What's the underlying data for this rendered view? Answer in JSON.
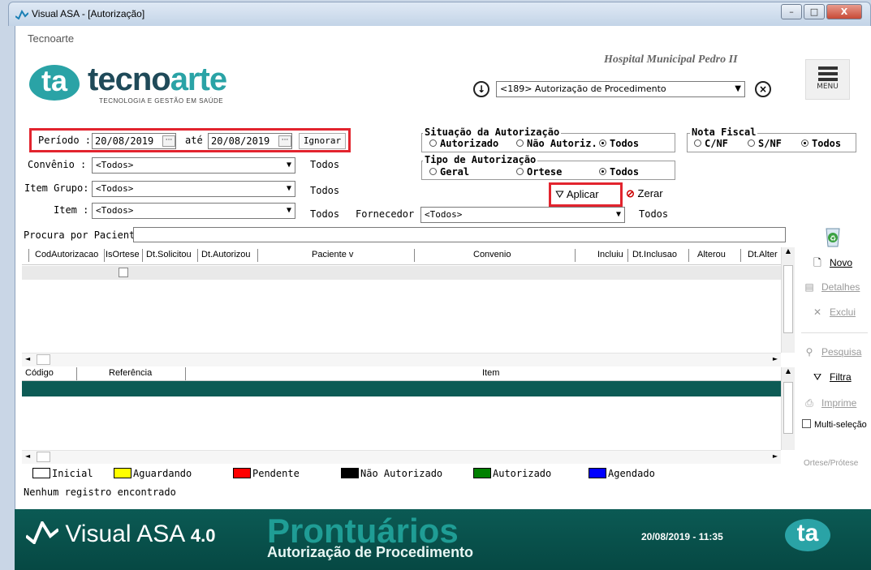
{
  "window": {
    "title": "Visual ASA - [Autorização]",
    "min": "–",
    "max": "□",
    "close": "X"
  },
  "header": {
    "company_label": "Tecnoarte",
    "hospital": "Hospital Municipal Pedro II",
    "logo_mark": "ta",
    "logo_word_a": "tecno",
    "logo_word_b": "arte",
    "logo_sub": "TECNOLOGIA E GESTÃO EM SAÚDE",
    "module_select": "<189> Autorização de Procedimento",
    "menu_label": "MENU"
  },
  "filters": {
    "periodo_label": "Período :",
    "periodo_de": "20/08/2019",
    "ate_label": "até",
    "periodo_ate": "20/08/2019",
    "dots": "···",
    "ignorar": "Ignorar",
    "convenio_label": "Convênio :",
    "convenio_value": "<Todos>",
    "convenio_todos": "Todos",
    "item_grupo_label": "Item Grupo:",
    "item_grupo_value": "<Todos>",
    "item_grupo_todos": "Todos",
    "item_label": "Item :",
    "item_value": "<Todos>",
    "item_todos": "Todos",
    "fornecedor_label": "Fornecedor :",
    "fornecedor_value": "<Todos>",
    "fornecedor_todos": "Todos",
    "paciente_label": "Procura por Paciente:",
    "paciente_value": "",
    "aplicar": "Aplicar",
    "zerar": "Zerar"
  },
  "situacao": {
    "title": "Situação da Autorização",
    "options": [
      "Autorizado",
      "Não Autoriz.",
      "Todos"
    ],
    "selected": 2
  },
  "tipo": {
    "title": "Tipo de Autorização",
    "options": [
      "Geral",
      "Ortese",
      "Todos"
    ],
    "selected": 2
  },
  "nota": {
    "title": "Nota Fiscal",
    "options": [
      "C/NF",
      "S/NF",
      "Todos"
    ],
    "selected": 2
  },
  "grid1": {
    "columns": [
      "CodAutorizacao",
      "IsOrtese",
      "Dt.Solicitou",
      "Dt.Autorizou",
      "Paciente v",
      "Convenio",
      "Incluiu",
      "Dt.Inclusao",
      "Alterou",
      "Dt.Alter"
    ]
  },
  "grid2": {
    "columns": [
      "Código",
      "Referência",
      "Item"
    ]
  },
  "side": {
    "novo": "Novo",
    "detalhes": "Detalhes",
    "exclui": "Exclui",
    "pesquisa": "Pesquisa",
    "filtra": "Filtra",
    "imprime": "Imprime",
    "multi": "Multi-seleção",
    "ortese": "Ortese/Prótese"
  },
  "legend": [
    {
      "label": "Inicial",
      "color": "#ffffff"
    },
    {
      "label": "Aguardando",
      "color": "#ffff00"
    },
    {
      "label": "Pendente",
      "color": "#ff0000"
    },
    {
      "label": "Não Autorizado",
      "color": "#000000"
    },
    {
      "label": "Autorizado",
      "color": "#008000"
    },
    {
      "label": "Agendado",
      "color": "#0000ff"
    }
  ],
  "status": "Nenhum registro encontrado",
  "footer": {
    "brand": "Visual ASA",
    "version": "4.0",
    "product": "Prontuários",
    "subtitle": "Autorização de Procedimento",
    "datetime": "20/08/2019 - 11:35",
    "logo": "ta"
  }
}
